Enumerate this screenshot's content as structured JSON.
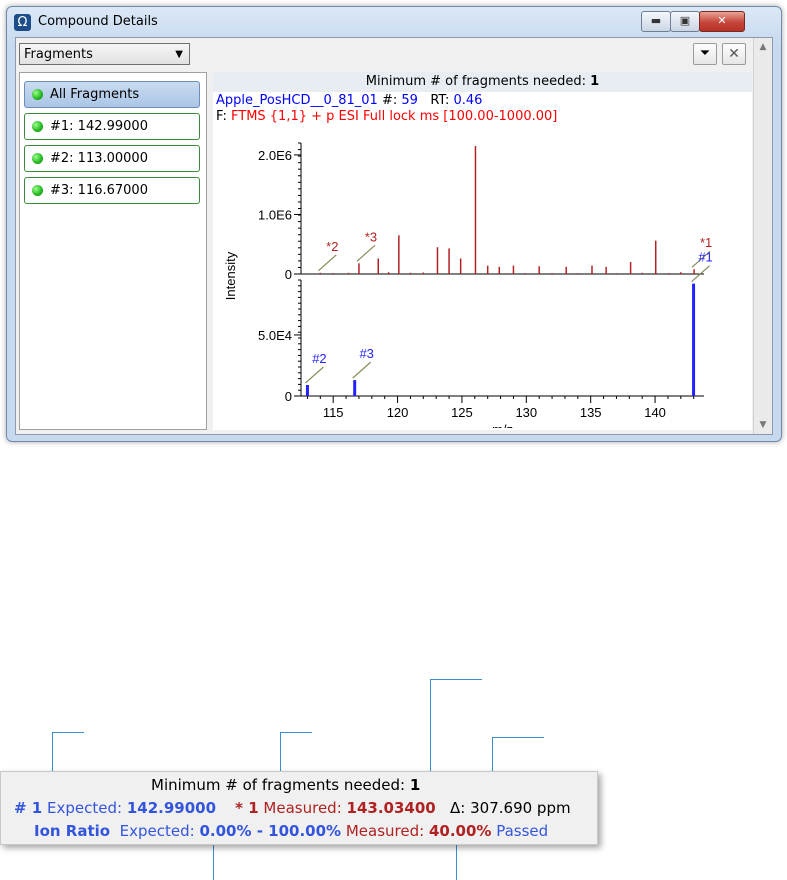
{
  "window": {
    "title": "Compound Details",
    "min_glyph": "▬",
    "max_glyph": "▣",
    "close_glyph": "✕"
  },
  "toolbar": {
    "view_select": "Fragments",
    "caret": "▼",
    "filter_glyph": "⏷",
    "clear_glyph": "✕"
  },
  "fragments": [
    {
      "label": "All Fragments",
      "selected": true
    },
    {
      "label": "#1: 142.99000",
      "selected": false
    },
    {
      "label": "#2: 113.00000",
      "selected": false
    },
    {
      "label": "#3: 116.67000",
      "selected": false
    }
  ],
  "spectrum": {
    "min_fragments_label": "Minimum # of fragments needed:",
    "min_fragments_value": "1",
    "file": "Apple_PosHCD__0_81_01",
    "scan_label": "#:",
    "scan_value": "59",
    "rt_label": "RT:",
    "rt_value": "0.46",
    "filter_prefix": "F:",
    "filter": "FTMS {1,1}  + p ESI Full lock ms [100.00-1000.00]"
  },
  "chart_data": {
    "type": "bar",
    "xlabel": "m/z",
    "ylabel": "Intensity",
    "xlim": [
      112.5,
      143.8
    ],
    "x_ticks": [
      "115",
      "120",
      "125",
      "130",
      "135",
      "140"
    ],
    "top": {
      "ylim": [
        0,
        2200000
      ],
      "y_ticks": [
        "0",
        "1.0E6",
        "2.0E6"
      ],
      "color": "#b22222",
      "peaks": [
        {
          "x": 114.0,
          "y": 20000
        },
        {
          "x": 115.0,
          "y": 15000
        },
        {
          "x": 116.2,
          "y": 20000
        },
        {
          "x": 117.0,
          "y": 180000
        },
        {
          "x": 118.5,
          "y": 260000
        },
        {
          "x": 119.3,
          "y": 30000
        },
        {
          "x": 120.1,
          "y": 650000
        },
        {
          "x": 121.0,
          "y": 20000
        },
        {
          "x": 122.0,
          "y": 25000
        },
        {
          "x": 123.1,
          "y": 450000
        },
        {
          "x": 124.0,
          "y": 430000
        },
        {
          "x": 124.9,
          "y": 260000
        },
        {
          "x": 126.05,
          "y": 2150000
        },
        {
          "x": 127.0,
          "y": 140000
        },
        {
          "x": 127.9,
          "y": 120000
        },
        {
          "x": 129.0,
          "y": 140000
        },
        {
          "x": 129.9,
          "y": 15000
        },
        {
          "x": 131.0,
          "y": 130000
        },
        {
          "x": 132.0,
          "y": 15000
        },
        {
          "x": 133.1,
          "y": 120000
        },
        {
          "x": 134.0,
          "y": 15000
        },
        {
          "x": 135.1,
          "y": 140000
        },
        {
          "x": 136.2,
          "y": 120000
        },
        {
          "x": 137.0,
          "y": 15000
        },
        {
          "x": 138.1,
          "y": 200000
        },
        {
          "x": 139.0,
          "y": 20000
        },
        {
          "x": 140.05,
          "y": 560000
        },
        {
          "x": 141.1,
          "y": 15000
        },
        {
          "x": 142.0,
          "y": 30000
        },
        {
          "x": 143.03,
          "y": 80000
        }
      ],
      "annotations": [
        {
          "text": "*2",
          "x": 113.0
        },
        {
          "text": "*3",
          "x": 116.67
        },
        {
          "text": "*1",
          "x": 143.03
        }
      ]
    },
    "bottom": {
      "ylim": [
        0,
        95000
      ],
      "y_ticks": [
        "0",
        "5.0E4"
      ],
      "color": "#2222ff",
      "peaks": [
        {
          "x": 113.0,
          "y": 9000
        },
        {
          "x": 116.67,
          "y": 13000
        },
        {
          "x": 142.99,
          "y": 92000
        }
      ],
      "annotations": [
        {
          "text": "#2",
          "x": 113.0
        },
        {
          "text": "#3",
          "x": 116.67
        },
        {
          "text": "#1",
          "x": 142.99
        }
      ]
    }
  },
  "callout": {
    "header": "Minimum # of fragments needed:",
    "header_value": "1",
    "frag_id": "# 1",
    "expected_label": "Expected:",
    "expected_value": "142.99000",
    "measured_id": "* 1",
    "measured_label": "Measured:",
    "measured_value": "143.03400",
    "delta": "Δ: 307.690 ppm",
    "ion_ratio_label": "Ion Ratio",
    "ratio_expected_label": "Expected:",
    "ratio_expected_value": "0.00% - 100.00%",
    "ratio_measured_label": "Measured:",
    "ratio_measured_value": "40.00%",
    "status": "Passed"
  }
}
